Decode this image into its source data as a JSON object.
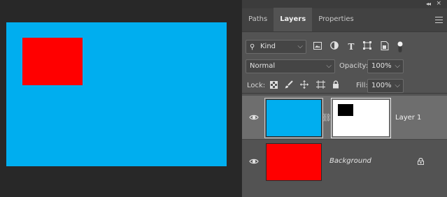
{
  "panel": {
    "tabs": [
      {
        "label": "Paths"
      },
      {
        "label": "Layers"
      },
      {
        "label": "Properties"
      }
    ],
    "filter": {
      "kind_label": "Kind",
      "icons": [
        "image-filter-icon",
        "adjustment-filter-icon",
        "type-filter-icon",
        "shape-filter-icon",
        "smart-object-filter-icon",
        "filter-toggle-icon"
      ]
    },
    "blend": {
      "mode": "Normal",
      "opacity_label": "Opacity:",
      "opacity_value": "100%"
    },
    "lock": {
      "label": "Lock:",
      "icons": [
        "lock-transparent-pixels-icon",
        "lock-image-pixels-icon",
        "lock-position-icon",
        "lock-artboard-icon",
        "lock-all-icon"
      ],
      "fill_label": "Fill:",
      "fill_value": "100%"
    },
    "layers": [
      {
        "name": "Layer 1",
        "thumb_color": "#00aeef",
        "has_mask": true,
        "selected": true
      },
      {
        "name": "Background",
        "thumb_color": "#ff0000",
        "locked": true,
        "selected": false
      }
    ]
  },
  "colors": {
    "canvas_bg": "#00aeef",
    "shape_fill": "#ff0000",
    "panel_bg": "#535353",
    "selected_layer_bg": "#6e6e6e"
  }
}
